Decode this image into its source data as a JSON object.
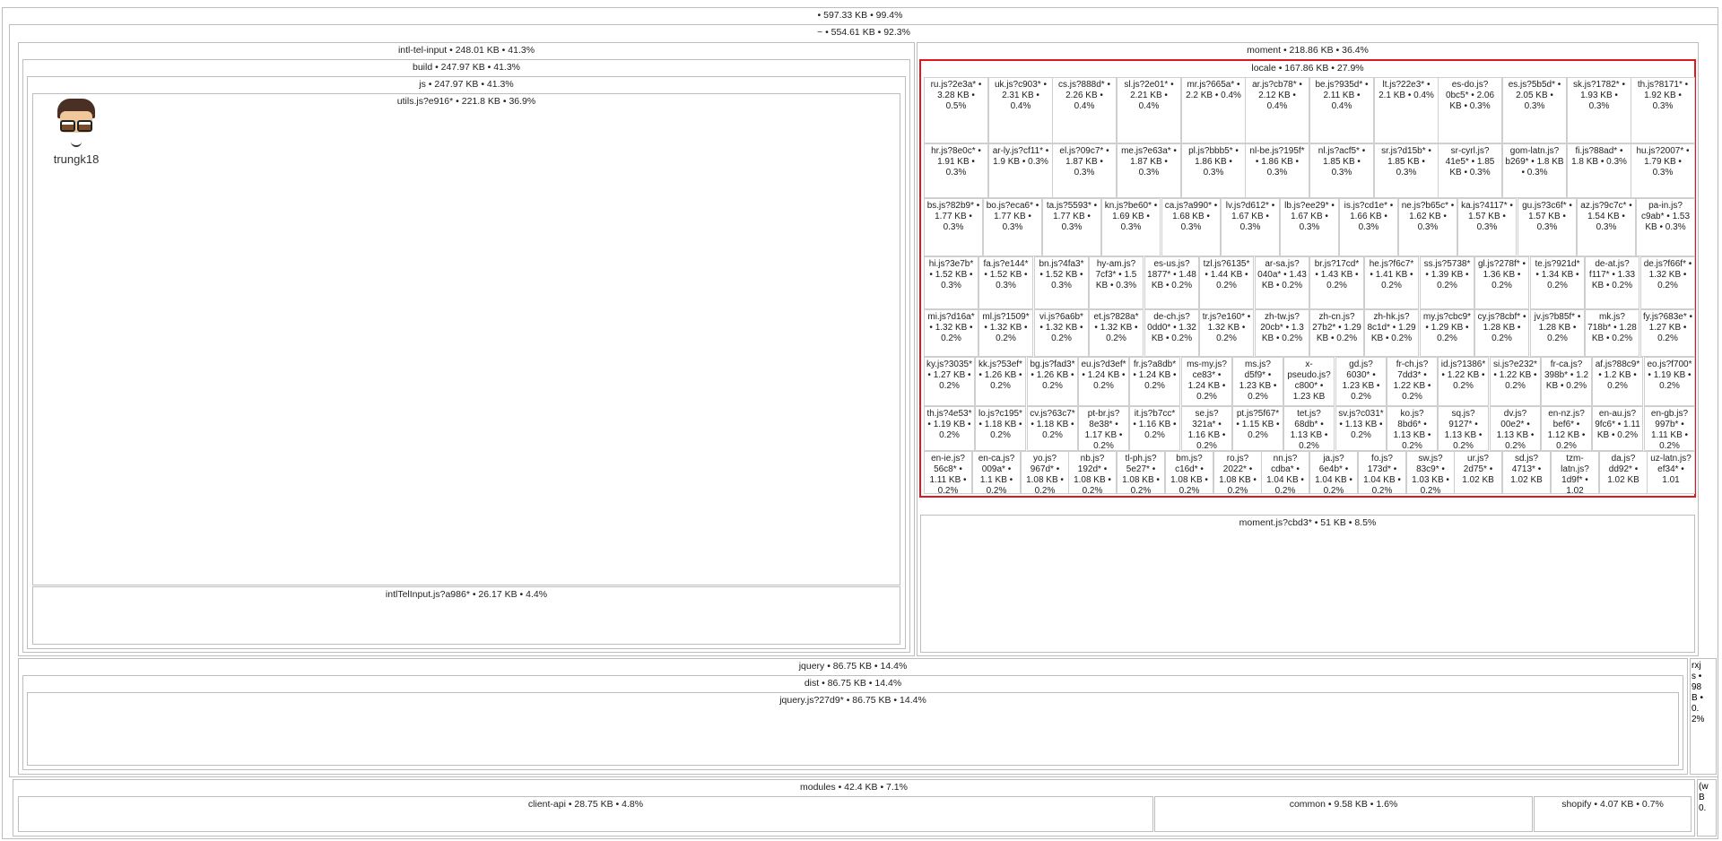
{
  "root": "• 597.33 KB • 99.4%",
  "home": "~ • 554.61 KB • 92.3%",
  "intl_tel_input": "intl-tel-input • 248.01 KB • 41.3%",
  "build": "build • 247.97 KB • 41.3%",
  "js": "js • 247.97 KB • 41.3%",
  "utils": "utils.js?e916* • 221.8 KB • 36.9%",
  "intlTelInput": "intlTelInput.js?a986* • 26.17 KB • 4.4%",
  "moment": "moment • 218.86 KB • 36.4%",
  "locale": "locale • 167.86 KB • 27.9%",
  "moment_js": "moment.js?cbd3* • 51 KB • 8.5%",
  "jquery": "jquery • 86.75 KB • 14.4%",
  "dist": "dist • 86.75 KB • 14.4%",
  "jquery_js": "jquery.js?27d9* • 86.75 KB • 14.4%",
  "rxjs": "rxjs • 98 B • 0.2%",
  "modules": "modules • 42.4 KB • 7.1%",
  "client_api": "client-api • 28.75 KB • 4.8%",
  "common": "common • 9.58 KB • 1.6%",
  "shopify": "shopify • 4.07 KB • 0.7%",
  "side_small": "(w B 0.",
  "logo_text": "trungk18",
  "locale_rows": [
    [
      "ru.js?2e3a* • 3.28 KB • 0.5%",
      "uk.js?c903* • 2.31 KB • 0.4%",
      "cs.js?888d* • 2.26 KB • 0.4%",
      "sl.js?2e01* • 2.21 KB • 0.4%",
      "mr.js?665a* • 2.2 KB • 0.4%",
      "ar.js?cb78* • 2.12 KB • 0.4%",
      "be.js?935d* • 2.11 KB • 0.4%",
      "lt.js?22e3* • 2.1 KB • 0.4%",
      "es-do.js?0bc5* • 2.06 KB • 0.3%",
      "es.js?5b5d* • 2.05 KB • 0.3%",
      "sk.js?1782* • 1.93 KB • 0.3%",
      "th.js?8171* • 1.92 KB • 0.3%"
    ],
    [
      "hr.js?8e0c* • 1.91 KB • 0.3%",
      "ar-ly.js?cf11* • 1.9 KB • 0.3%",
      "el.js?09c7* • 1.87 KB • 0.3%",
      "me.js?e63a* • 1.87 KB • 0.3%",
      "pl.js?bbb5* • 1.86 KB • 0.3%",
      "nl-be.js?195f* • 1.86 KB • 0.3%",
      "nl.js?acf5* • 1.85 KB • 0.3%",
      "sr.js?d15b* • 1.85 KB • 0.3%",
      "sr-cyrl.js?41e5* • 1.85 KB • 0.3%",
      "gom-latn.js?b269* • 1.8 KB • 0.3%",
      "fi.js?88ad* • 1.8 KB • 0.3%",
      "hu.js?2007* • 1.79 KB • 0.3%"
    ],
    [
      "bs.js?82b9* • 1.77 KB • 0.3%",
      "bo.js?eca6* • 1.77 KB • 0.3%",
      "ta.js?5593* • 1.77 KB • 0.3%",
      "kn.js?be60* • 1.69 KB • 0.3%",
      "ca.js?a990* • 1.68 KB • 0.3%",
      "lv.js?d612* • 1.67 KB • 0.3%",
      "lb.js?ee29* • 1.67 KB • 0.3%",
      "is.js?cd1e* • 1.66 KB • 0.3%",
      "ne.js?b65c* • 1.62 KB • 0.3%",
      "ka.js?4117* • 1.57 KB • 0.3%",
      "gu.js?3c6f* • 1.57 KB • 0.3%",
      "az.js?9c7c* • 1.54 KB • 0.3%",
      "pa-in.js?c9ab* • 1.53 KB • 0.3%"
    ],
    [
      "hi.js?3e7b* • 1.52 KB • 0.3%",
      "fa.js?e144* • 1.52 KB • 0.3%",
      "bn.js?4fa3* • 1.52 KB • 0.3%",
      "hy-am.js?7cf3* • 1.5 KB • 0.3%",
      "es-us.js?1877* • 1.48 KB • 0.2%",
      "tzl.js?6135* • 1.44 KB • 0.2%",
      "ar-sa.js?040a* • 1.43 KB • 0.2%",
      "br.js?17cd* • 1.43 KB • 0.2%",
      "he.js?f6c7* • 1.41 KB • 0.2%",
      "ss.js?5738* • 1.39 KB • 0.2%",
      "gl.js?278f* • 1.36 KB • 0.2%",
      "te.js?921d* • 1.34 KB • 0.2%",
      "de-at.js?f117* • 1.33 KB • 0.2%",
      "de.js?f66f* • 1.32 KB • 0.2%"
    ],
    [
      "mi.js?d16a* • 1.32 KB • 0.2%",
      "ml.js?1509* • 1.32 KB • 0.2%",
      "vi.js?6a6b* • 1.32 KB • 0.2%",
      "et.js?828a* • 1.32 KB • 0.2%",
      "de-ch.js?0dd0* • 1.32 KB • 0.2%",
      "tr.js?e160* • 1.32 KB • 0.2%",
      "zh-tw.js?20cb* • 1.3 KB • 0.2%",
      "zh-cn.js?27b2* • 1.29 KB • 0.2%",
      "zh-hk.js?8c1d* • 1.29 KB • 0.2%",
      "my.js?cbc9* • 1.29 KB • 0.2%",
      "cy.js?8cbf* • 1.28 KB • 0.2%",
      "jv.js?b85f* • 1.28 KB • 0.2%",
      "mk.js?718b* • 1.28 KB • 0.2%",
      "fy.js?683e* • 1.27 KB • 0.2%"
    ],
    [
      "ky.js?3035* • 1.27 KB • 0.2%",
      "kk.js?53ef* • 1.26 KB • 0.2%",
      "bg.js?fad3* • 1.26 KB • 0.2%",
      "eu.js?d3ef* • 1.24 KB • 0.2%",
      "fr.js?a8db* • 1.24 KB • 0.2%",
      "ms-my.js?ce83* • 1.24 KB • 0.2%",
      "ms.js?d5f9* • 1.23 KB • 0.2%",
      "x-pseudo.js?c800* • 1.23 KB",
      "gd.js?6030* • 1.23 KB • 0.2%",
      "fr-ch.js?7dd3* • 1.22 KB • 0.2%",
      "id.js?1386* • 1.22 KB • 0.2%",
      "si.js?e232* • 1.22 KB • 0.2%",
      "fr-ca.js?398b* • 1.2 KB • 0.2%",
      "af.js?88c9* • 1.2 KB • 0.2%",
      "eo.js?f700* • 1.19 KB • 0.2%"
    ],
    [
      "th.js?4e53* • 1.19 KB • 0.2%",
      "lo.js?c195* • 1.18 KB • 0.2%",
      "cv.js?63c7* • 1.18 KB • 0.2%",
      "pt-br.js?8e38* • 1.17 KB • 0.2%",
      "it.js?b7cc* • 1.16 KB • 0.2%",
      "se.js?321a* • 1.16 KB • 0.2%",
      "pt.js?5f67* • 1.15 KB • 0.2%",
      "tet.js?68db* • 1.13 KB • 0.2%",
      "sv.js?c031* • 1.13 KB • 0.2%",
      "ko.js?8bd6* • 1.13 KB • 0.2%",
      "sq.js?9127* • 1.13 KB • 0.2%",
      "dv.js?00e2* • 1.13 KB • 0.2%",
      "en-nz.js?bef6* • 1.12 KB • 0.2%",
      "en-au.js?9fc6* • 1.11 KB • 0.2%",
      "en-gb.js?997b* • 1.11 KB • 0.2%"
    ],
    [
      "en-ie.js?56c8* • 1.11 KB • 0.2%",
      "en-ca.js?009a* • 1.1 KB • 0.2%",
      "yo.js?967d* • 1.08 KB • 0.2%",
      "nb.js?192d* • 1.08 KB • 0.2%",
      "tl-ph.js?5e27* • 1.08 KB • 0.2%",
      "bm.js?c16d* • 1.08 KB • 0.2%",
      "ro.js?2022* • 1.08 KB • 0.2%",
      "nn.js?cdba* • 1.04 KB • 0.2%",
      "ja.js?6e4b* • 1.04 KB • 0.2%",
      "fo.js?173d* • 1.04 KB • 0.2%",
      "sw.js?83c9* • 1.03 KB • 0.2%",
      "ur.js?2d75* • 1.02 KB",
      "sd.js?4713* • 1.02 KB",
      "tzm-latn.js?1d9f* • 1.02",
      "da.js?dd92* • 1.02 KB",
      "uz-latn.js?ef34* • 1.01"
    ]
  ],
  "colors": {
    "selected_border": "#e0171f",
    "box_border": "#bdbdbd"
  }
}
